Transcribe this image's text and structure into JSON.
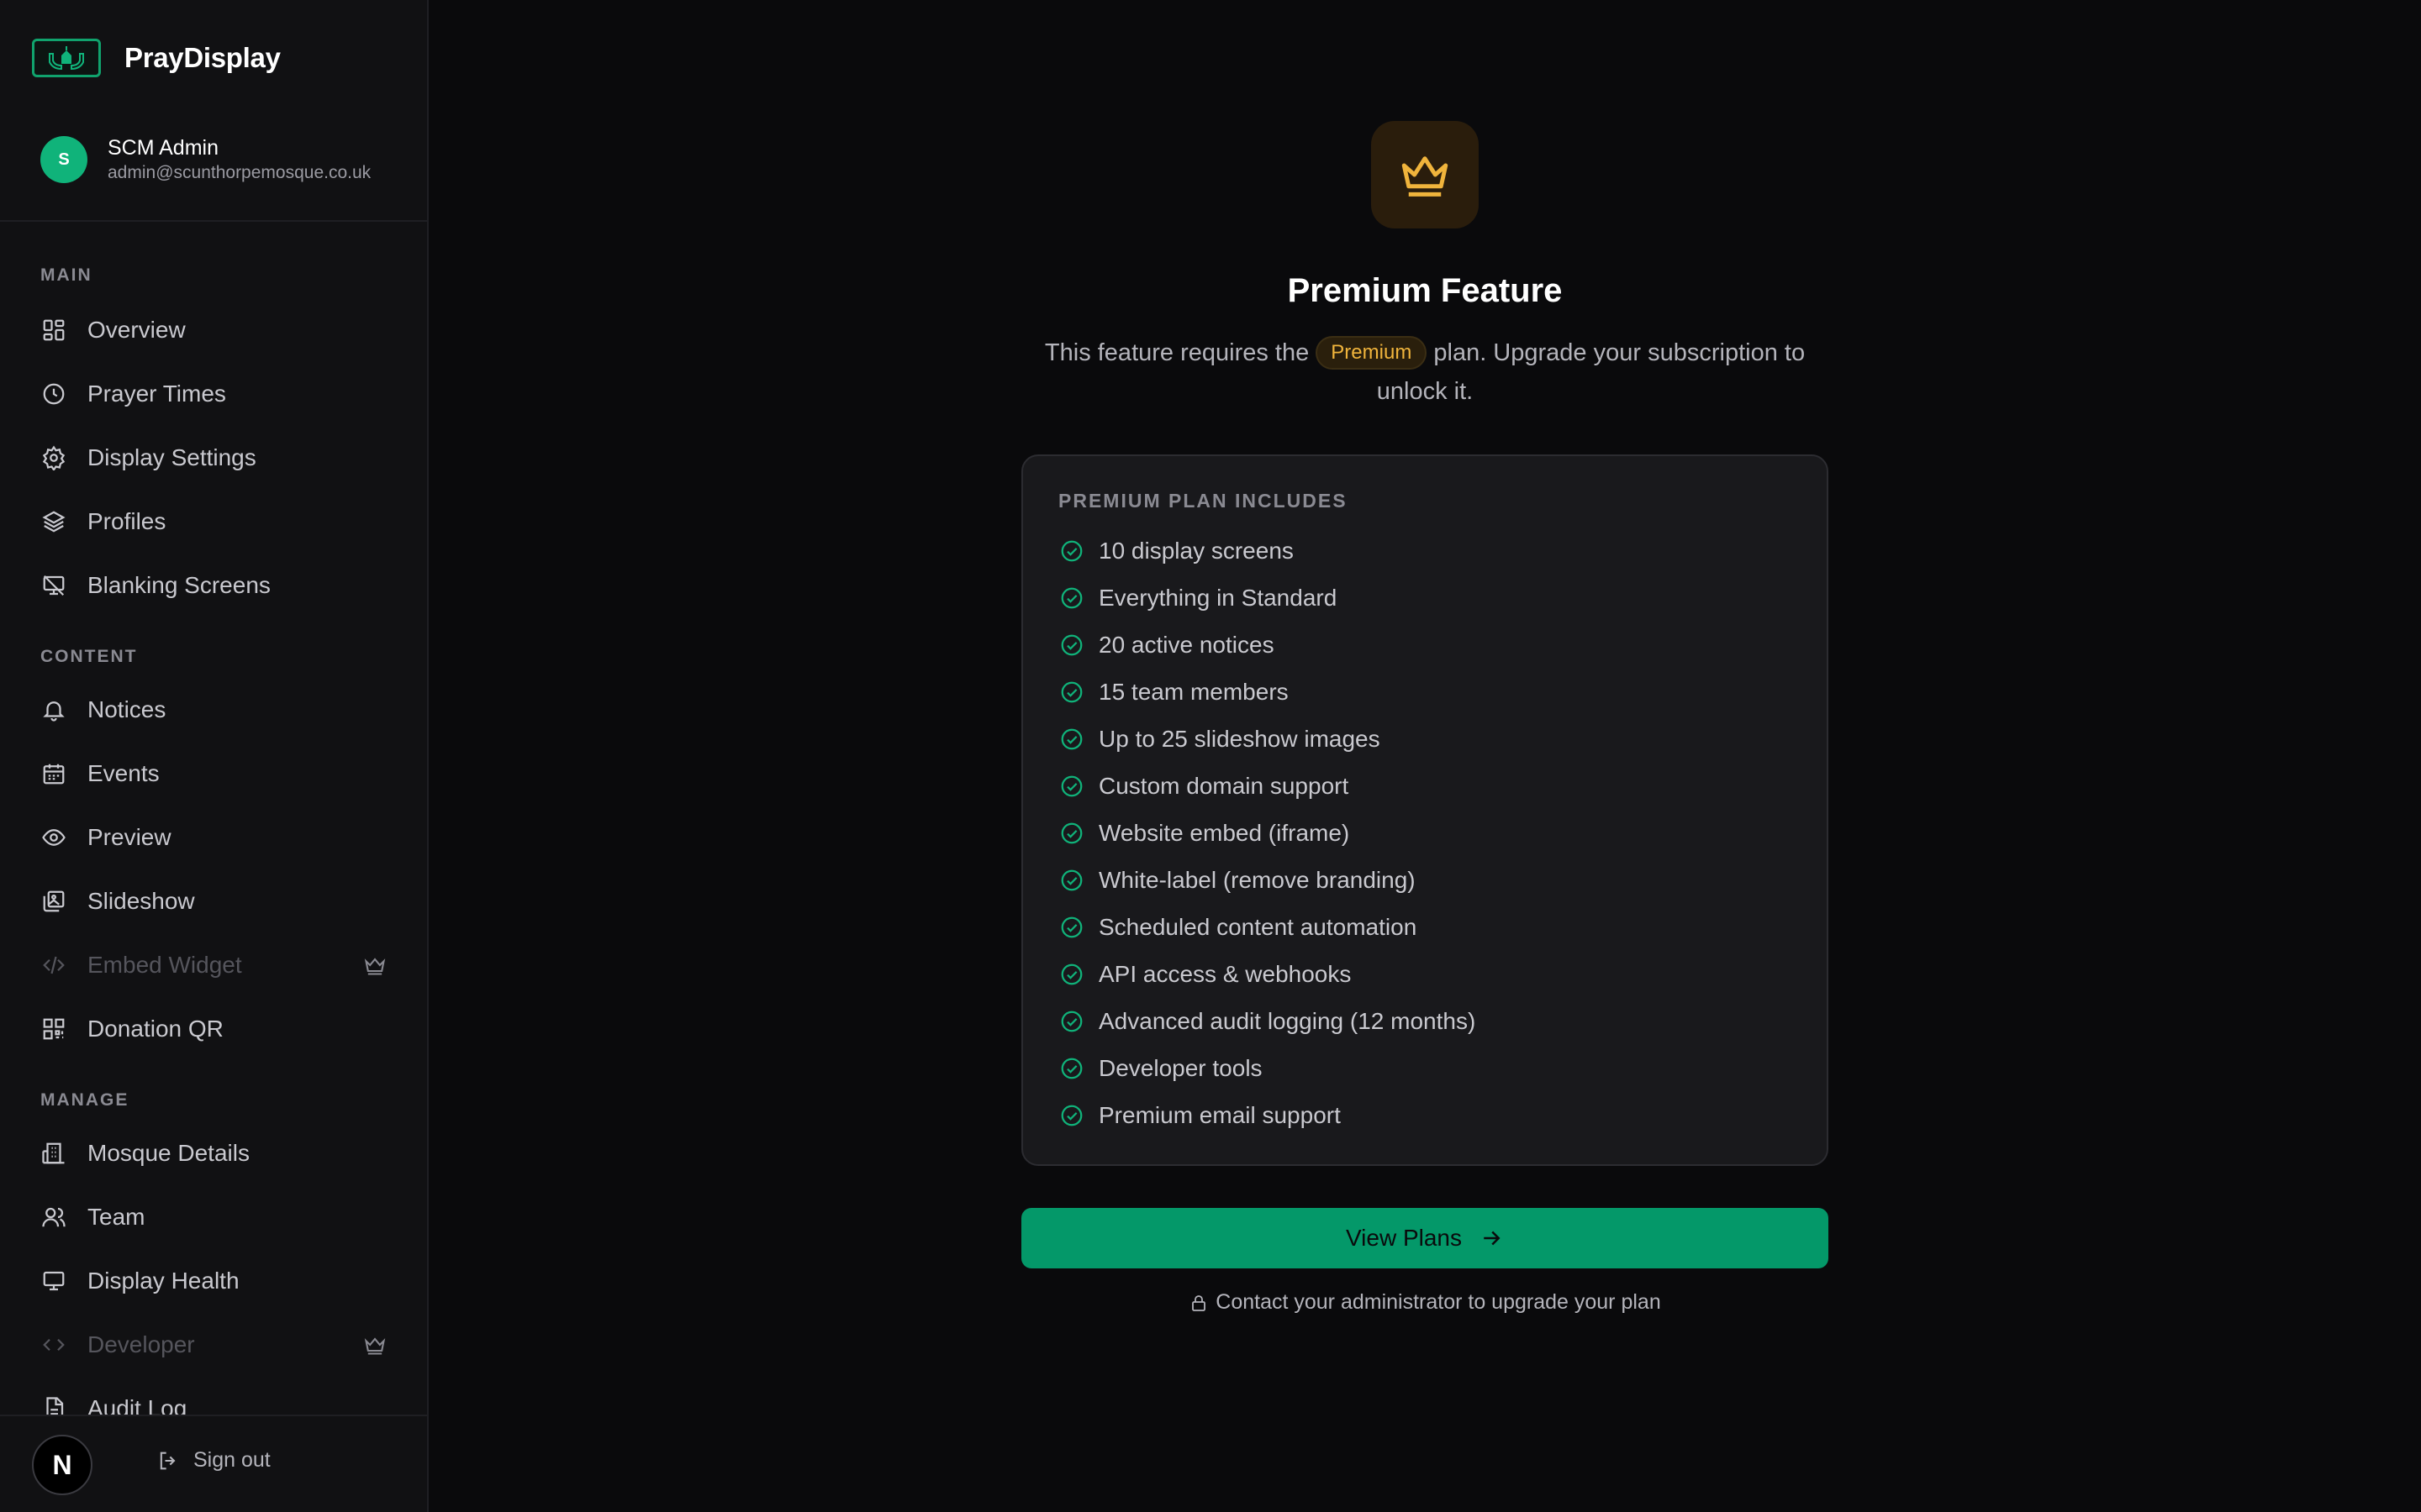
{
  "app": {
    "name": "PrayDisplay"
  },
  "user": {
    "initial": "S",
    "name": "SCM Admin",
    "email": "admin@scunthorpemosque.co.uk"
  },
  "sidebar": {
    "sections": {
      "main": "MAIN",
      "content": "CONTENT",
      "manage": "MANAGE"
    },
    "items": [
      {
        "label": "Overview",
        "icon": "grid-icon"
      },
      {
        "label": "Prayer Times",
        "icon": "clock-icon"
      },
      {
        "label": "Display Settings",
        "icon": "gear-icon"
      },
      {
        "label": "Profiles",
        "icon": "layers-icon"
      },
      {
        "label": "Blanking Screens",
        "icon": "monitor-off-icon"
      },
      {
        "label": "Notices",
        "icon": "bell-icon"
      },
      {
        "label": "Events",
        "icon": "calendar-icon"
      },
      {
        "label": "Preview",
        "icon": "eye-icon"
      },
      {
        "label": "Slideshow",
        "icon": "images-icon"
      },
      {
        "label": "Embed Widget",
        "icon": "code-icon",
        "locked": true
      },
      {
        "label": "Donation QR",
        "icon": "qr-icon"
      },
      {
        "label": "Mosque Details",
        "icon": "building-icon"
      },
      {
        "label": "Team",
        "icon": "users-icon"
      },
      {
        "label": "Display Health",
        "icon": "monitor-icon"
      },
      {
        "label": "Developer",
        "icon": "code-brackets-icon",
        "locked": true
      },
      {
        "label": "Audit Log",
        "icon": "file-icon"
      }
    ],
    "footer": {
      "badge": "N",
      "signout": "Sign out"
    }
  },
  "main": {
    "title": "Premium Feature",
    "desc_before": "This feature requires the ",
    "plan_badge": "Premium",
    "desc_after": " plan. Upgrade your subscription to unlock it.",
    "card_header": "PREMIUM PLAN INCLUDES",
    "features": [
      "10 display screens",
      "Everything in Standard",
      "20 active notices",
      "15 team members",
      "Up to 25 slideshow images",
      "Custom domain support",
      "Website embed (iframe)",
      "White-label (remove branding)",
      "Scheduled content automation",
      "API access & webhooks",
      "Advanced audit logging (12 months)",
      "Developer tools",
      "Premium email support"
    ],
    "cta_label": "View Plans",
    "note": "Contact your administrator to upgrade your plan"
  },
  "colors": {
    "accent": "#049869",
    "check": "#10b37a",
    "premium": "#f0b43c",
    "background": "#0a0a0c",
    "sidebar": "#111113"
  }
}
